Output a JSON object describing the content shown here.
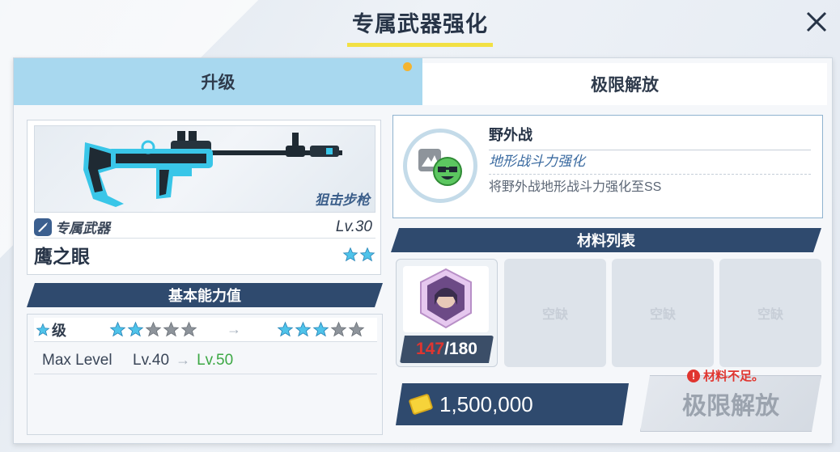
{
  "title": "专属武器强化",
  "tabs": [
    {
      "label": "升级",
      "active": false
    },
    {
      "label": "极限解放",
      "active": true
    }
  ],
  "weapon": {
    "type": "狙击步枪",
    "category": "专属武器",
    "level": "Lv.30",
    "name": "鹰之眼",
    "stars": 2
  },
  "basic_stats": {
    "header": "基本能力值",
    "grade_label": "级",
    "grade_from_stars": 2,
    "grade_to_stars": 3,
    "grade_total_stars": 5,
    "max_level_label": "Max Level",
    "max_level_from": "Lv.40",
    "max_level_to": "Lv.50"
  },
  "skill": {
    "name": "野外战",
    "subtitle": "地形战斗力强化",
    "description": "将野外战地形战斗力强化至SS"
  },
  "materials": {
    "header": "材料列表",
    "item_count_have": "147",
    "item_count_separator": "/",
    "item_count_need": "180",
    "empty_label": "空缺"
  },
  "cost": "1,500,000",
  "warning": "材料不足。",
  "limit_button": "极限解放",
  "colors": {
    "accent_blue": "#a8d8ef",
    "header_navy": "#2f4a6e",
    "star_blue": "#4fc3ea",
    "warn_red": "#e0352f",
    "green": "#3da845"
  }
}
